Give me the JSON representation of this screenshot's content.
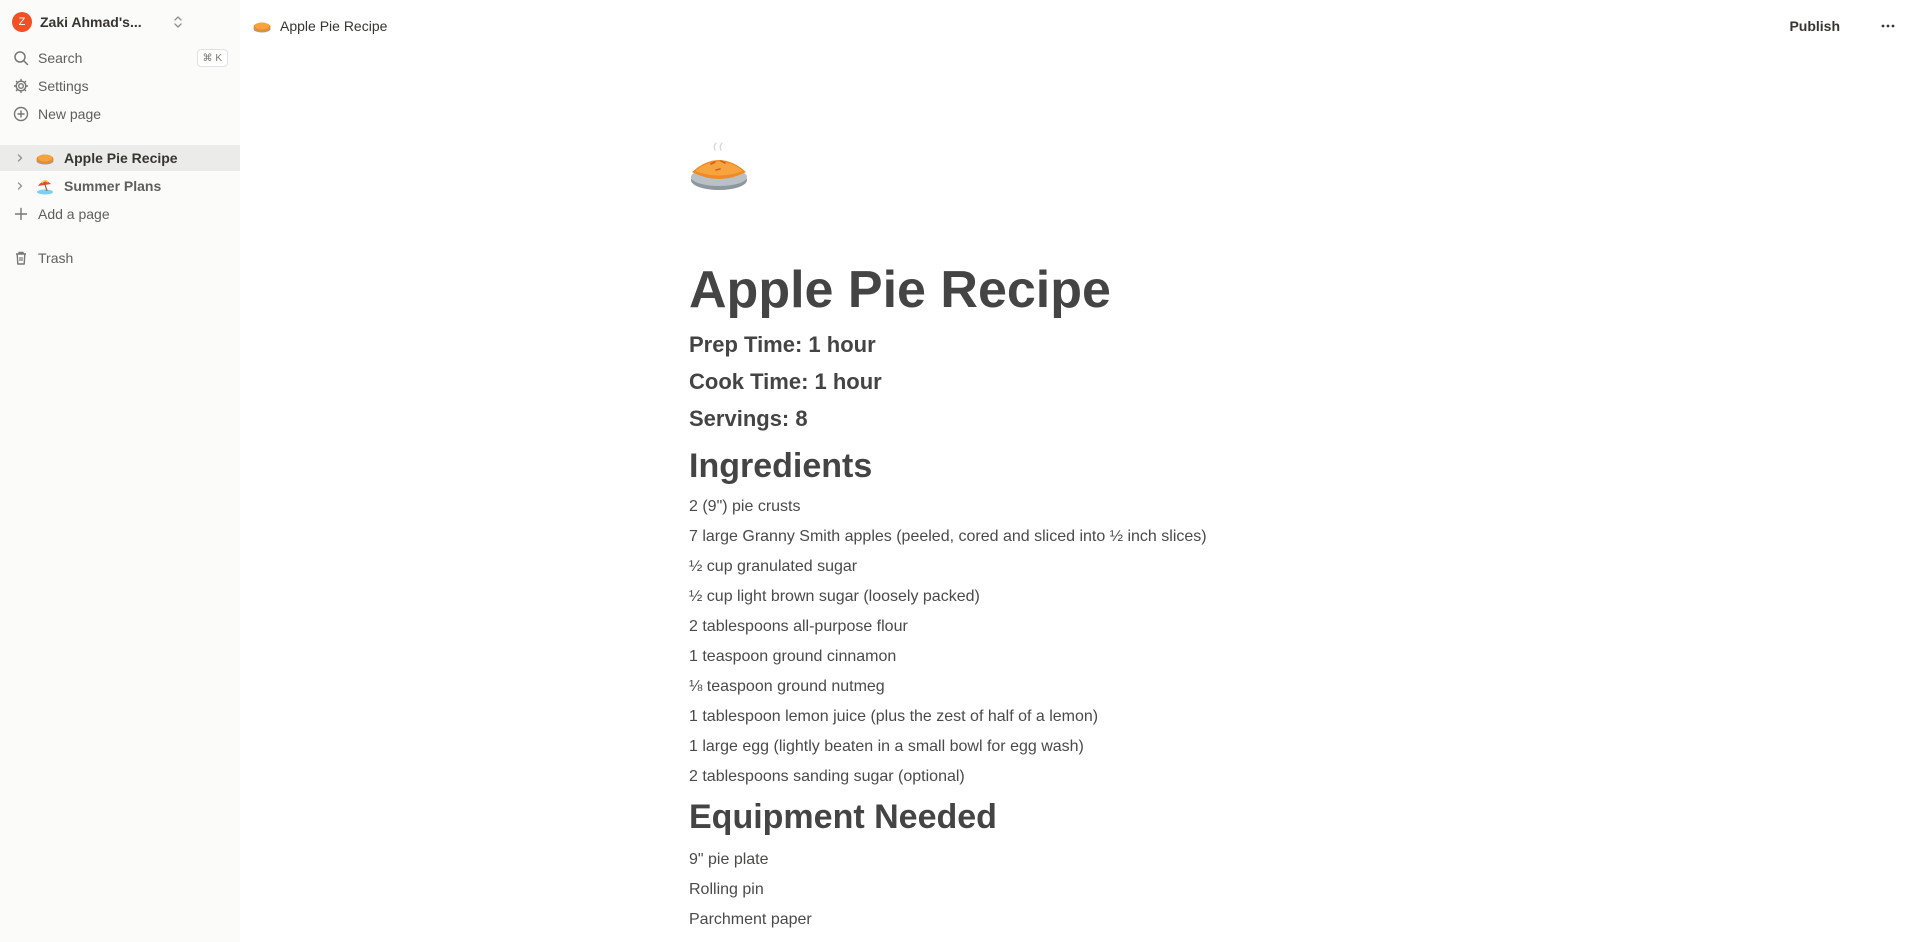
{
  "sidebar": {
    "workspace": {
      "avatar_letter": "Z",
      "name": "Zaki Ahmad's..."
    },
    "search": {
      "label": "Search",
      "shortcut": "⌘ K"
    },
    "settings": {
      "label": "Settings"
    },
    "new_page": {
      "label": "New page"
    },
    "pages": [
      {
        "label": "Apple Pie Recipe",
        "icon": "pie-emoji"
      },
      {
        "label": "Summer Plans",
        "icon": "beach-umbrella-emoji"
      }
    ],
    "add_page": {
      "label": "Add a page"
    },
    "trash": {
      "label": "Trash"
    }
  },
  "topbar": {
    "breadcrumb": "Apple Pie Recipe",
    "publish_label": "Publish"
  },
  "page": {
    "title": "Apple Pie Recipe",
    "meta": [
      "Prep Time: 1 hour",
      "Cook Time: 1 hour",
      "Servings: 8"
    ],
    "ingredients_heading": "Ingredients",
    "ingredients": [
      "2 (9\") pie crusts",
      "7 large Granny Smith apples (peeled, cored and sliced into ½ inch slices)",
      "½ cup granulated sugar",
      "½ cup light brown sugar (loosely packed)",
      "2 tablespoons all-purpose flour",
      "1 teaspoon ground cinnamon",
      "⅛ teaspoon ground nutmeg",
      "1 tablespoon lemon juice (plus the zest of half of a lemon)",
      "1 large egg (lightly beaten in a small bowl for egg wash)",
      "2 tablespoons sanding sugar (optional)"
    ],
    "equipment_heading": "Equipment Needed",
    "equipment": [
      "9\" pie plate",
      "Rolling pin",
      "Parchment paper"
    ]
  },
  "colors": {
    "accent": "#ef5124",
    "sidebar_bg": "#fbfbfa",
    "active_row": "#ebebea",
    "text": "#37352f"
  }
}
